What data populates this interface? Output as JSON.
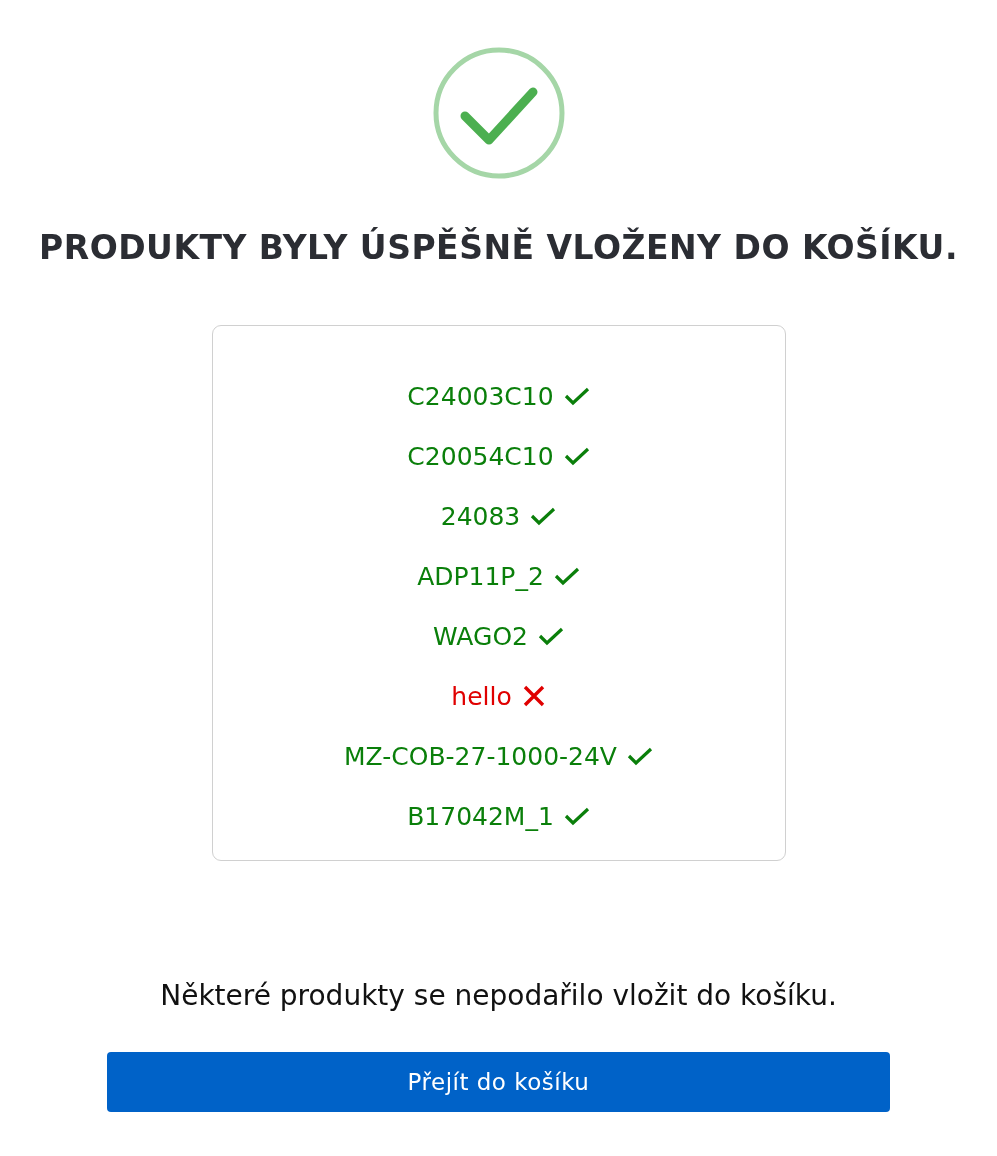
{
  "title": "PRODUKTY BYLY ÚSPĚŠNĚ VLOŽENY DO KOŠÍKU.",
  "products": [
    {
      "code": "C24003C10",
      "added": true
    },
    {
      "code": "C20054C10",
      "added": true
    },
    {
      "code": "24083",
      "added": true
    },
    {
      "code": "ADP11P_2",
      "added": true
    },
    {
      "code": "WAGO2",
      "added": true
    },
    {
      "code": "hello",
      "added": false
    },
    {
      "code": "MZ-COB-27-1000-24V",
      "added": true
    },
    {
      "code": "B17042M_1",
      "added": true
    }
  ],
  "message": "Některé produkty se nepodařilo vložit do košíku.",
  "button": "Přejít do košíku"
}
